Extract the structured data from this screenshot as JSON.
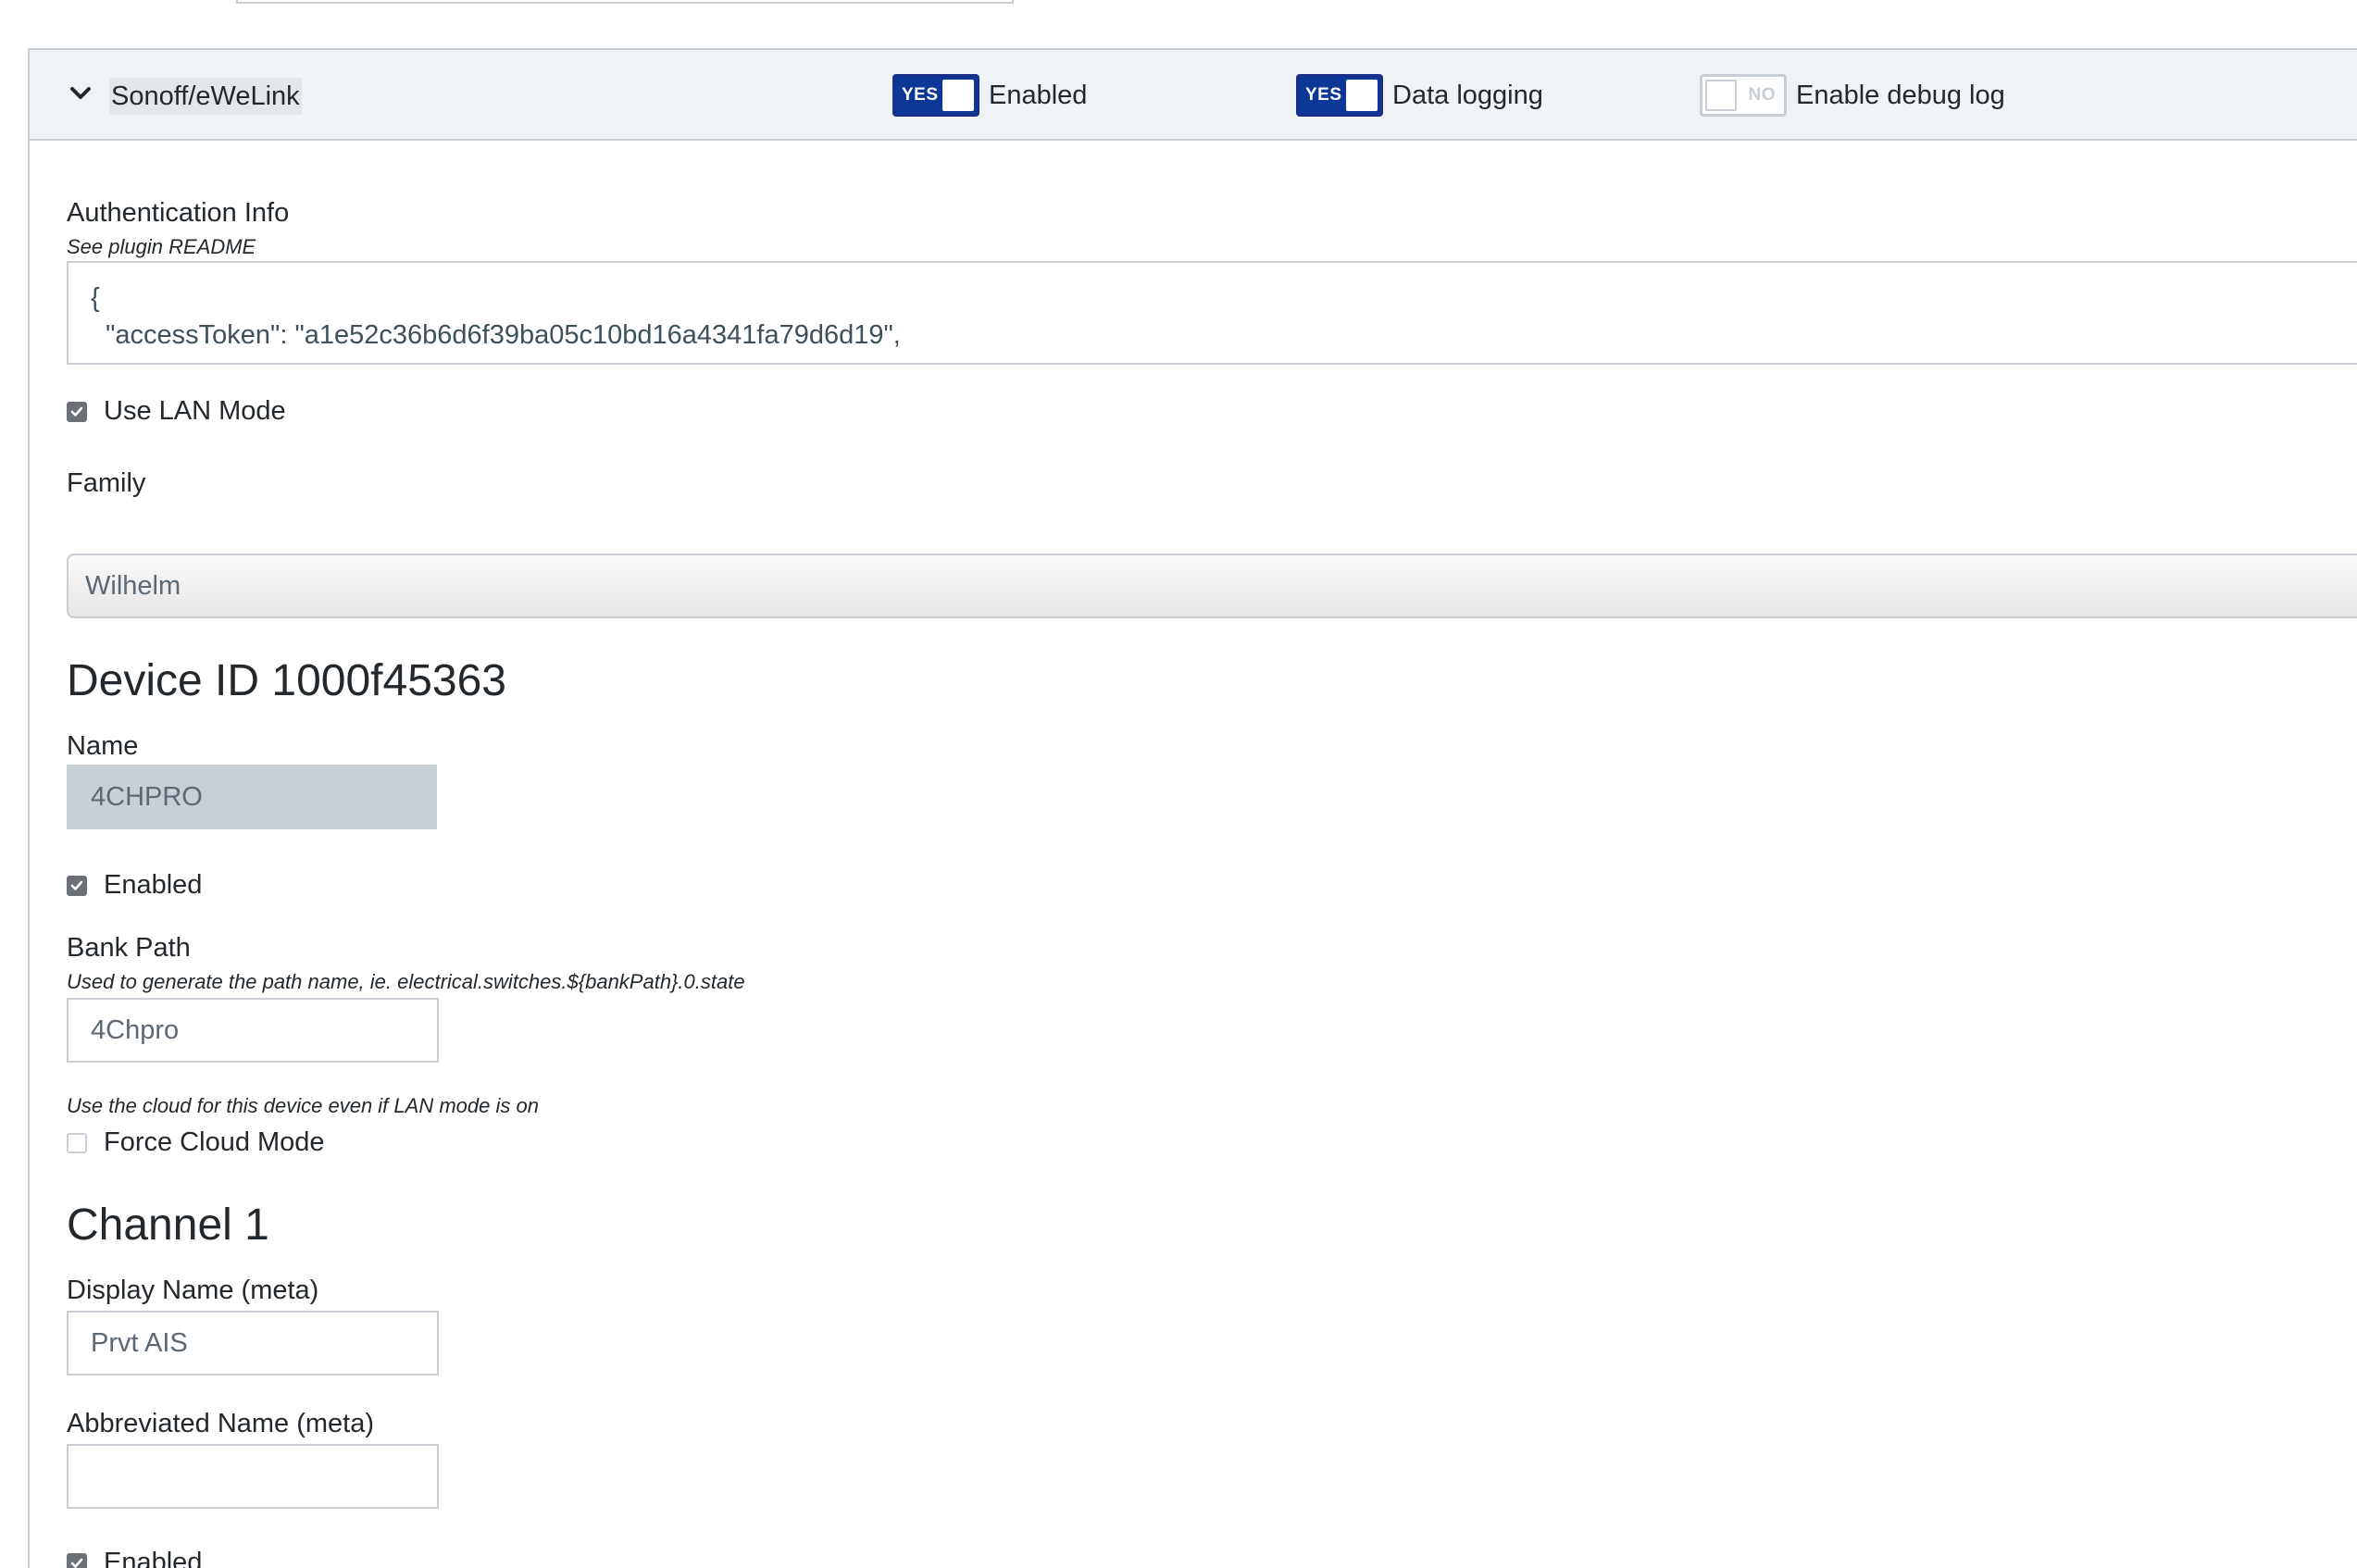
{
  "header": {
    "plugin_name": "Sonoff/eWeLink",
    "toggles": [
      {
        "state_label": "YES",
        "on": true,
        "label": "Enabled"
      },
      {
        "state_label": "YES",
        "on": true,
        "label": "Data logging"
      },
      {
        "state_label": "NO",
        "on": false,
        "label": "Enable debug log"
      }
    ]
  },
  "auth": {
    "label": "Authentication Info",
    "help": "See plugin README",
    "value_lines": [
      "{",
      "  \"accessToken\": \"a1e52c36b6d6f39ba05c10bd16a4341fa79d6d19\","
    ]
  },
  "lan_mode": {
    "label": "Use LAN Mode",
    "checked": true
  },
  "family": {
    "label": "Family",
    "value": "Wilhelm"
  },
  "device": {
    "heading": "Device ID 1000f45363",
    "name_label": "Name",
    "name_value": "4CHPRO",
    "enabled_label": "Enabled",
    "enabled_checked": true,
    "bank_path_label": "Bank Path",
    "bank_path_help": "Used to generate the path name, ie. electrical.switches.${bankPath}.0.state",
    "bank_path_value": "4Chpro",
    "cloud_help": "Use the cloud for this device even if LAN mode is on",
    "force_cloud_label": "Force Cloud Mode",
    "force_cloud_checked": false
  },
  "channel": {
    "heading": "Channel 1",
    "display_name_label": "Display Name (meta)",
    "display_name_value": "Prvt AIS",
    "abbrev_label": "Abbreviated Name (meta)",
    "abbrev_value": "",
    "enabled_label": "Enabled",
    "enabled_checked": true
  }
}
